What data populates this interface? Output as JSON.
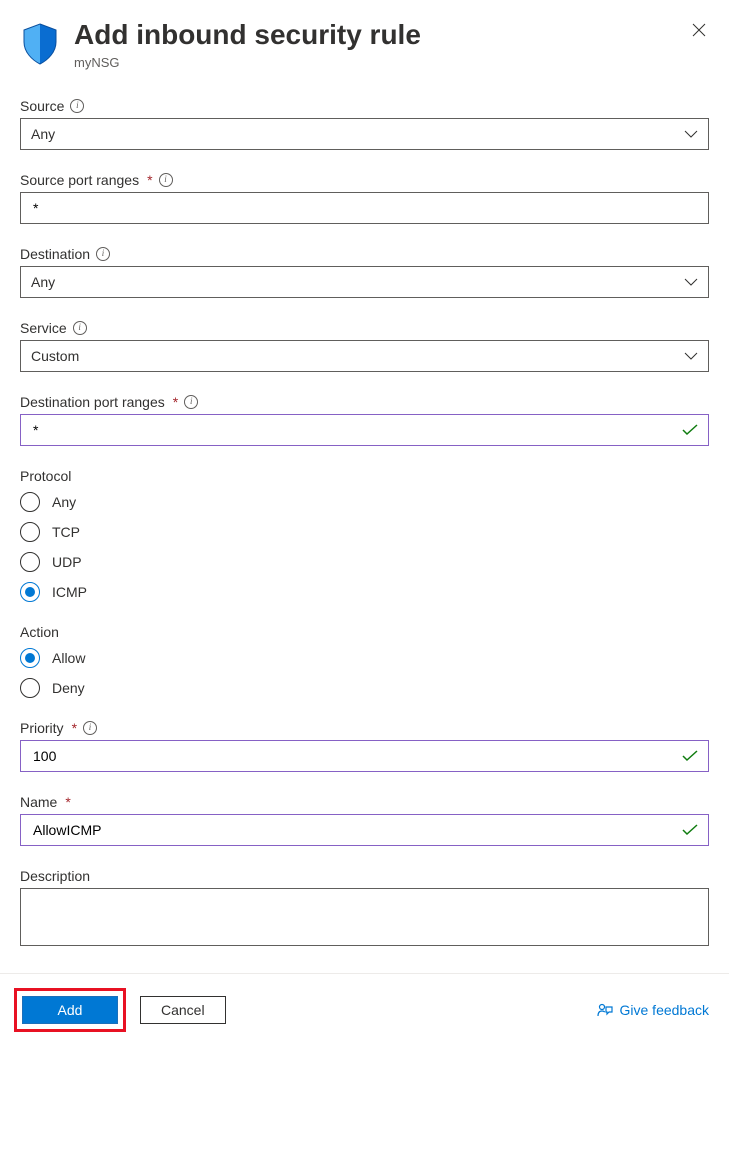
{
  "header": {
    "title": "Add inbound security rule",
    "subtitle": "myNSG"
  },
  "fields": {
    "source": {
      "label": "Source",
      "value": "Any"
    },
    "source_port_ranges": {
      "label": "Source port ranges",
      "value": "*"
    },
    "destination": {
      "label": "Destination",
      "value": "Any"
    },
    "service": {
      "label": "Service",
      "value": "Custom"
    },
    "dest_port_ranges": {
      "label": "Destination port ranges",
      "value": "*"
    },
    "protocol": {
      "label": "Protocol",
      "options": [
        "Any",
        "TCP",
        "UDP",
        "ICMP"
      ],
      "selected": "ICMP"
    },
    "action": {
      "label": "Action",
      "options": [
        "Allow",
        "Deny"
      ],
      "selected": "Allow"
    },
    "priority": {
      "label": "Priority",
      "value": "100"
    },
    "name": {
      "label": "Name",
      "value": "AllowICMP"
    },
    "description": {
      "label": "Description",
      "value": ""
    }
  },
  "footer": {
    "add": "Add",
    "cancel": "Cancel",
    "feedback": "Give feedback"
  }
}
